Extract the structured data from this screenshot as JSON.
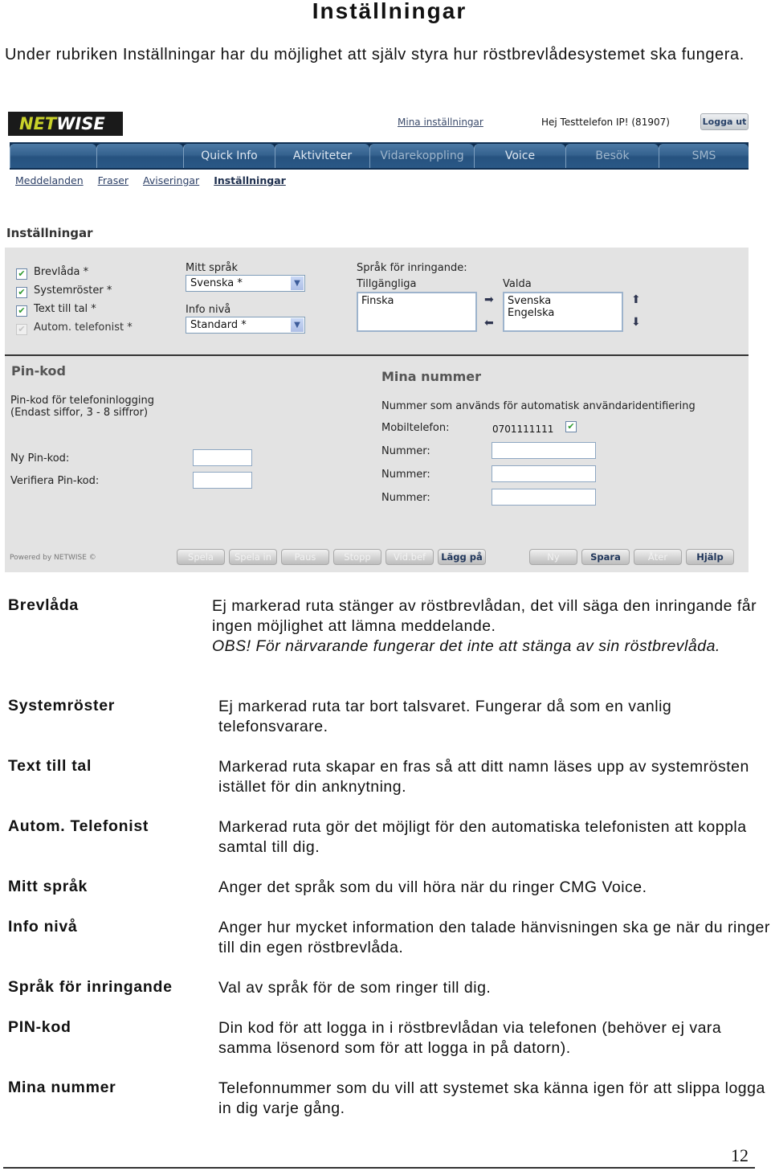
{
  "document": {
    "title": "Inställningar",
    "intro": "Under rubriken Inställningar har du möjlighet att själv styra hur röstbrevlådesystemet ska fungera.",
    "page_number": "12"
  },
  "app": {
    "logo": {
      "part1": "NET",
      "part2": "WISE"
    },
    "top_link": "Mina inställningar",
    "greeting": "Hej Testtelefon IP! (81907)",
    "logout_label": "Logga ut",
    "tabs": [
      {
        "label": ""
      },
      {
        "label": ""
      },
      {
        "label": "Quick Info"
      },
      {
        "label": "Aktiviteter"
      },
      {
        "label": "Vidarekoppling"
      },
      {
        "label": "Voice"
      },
      {
        "label": "Besök"
      },
      {
        "label": "SMS"
      }
    ],
    "subnav": [
      {
        "label": "Meddelanden",
        "active": false
      },
      {
        "label": "Fraser",
        "active": false
      },
      {
        "label": "Aviseringar",
        "active": false
      },
      {
        "label": "Inställningar",
        "active": true
      }
    ],
    "section_title": "Inställningar",
    "settings": {
      "checkboxes": [
        {
          "label": "Brevlåda *",
          "checked": true,
          "enabled": true
        },
        {
          "label": "Systemröster *",
          "checked": true,
          "enabled": true
        },
        {
          "label": "Text till tal *",
          "checked": true,
          "enabled": true
        },
        {
          "label": "Autom. telefonist *",
          "checked": true,
          "enabled": false
        }
      ],
      "my_language": {
        "label": "Mitt språk",
        "value": "Svenska *"
      },
      "info_level": {
        "label": "Info nivå",
        "value": "Standard *"
      },
      "caller_language": {
        "label": "Språk för inringande:",
        "available_label": "Tillgängliga",
        "available": [
          "Finska"
        ],
        "selected_label": "Valda",
        "selected": [
          "Svenska",
          "Engelska"
        ]
      }
    },
    "pin": {
      "title": "Pin-kod",
      "desc_line1": "Pin-kod för telefoninlogging",
      "desc_line2": "(Endast siffor, 3 - 8 siffror)",
      "new_label": "Ny Pin-kod:",
      "new_value": "",
      "verify_label": "Verifiera Pin-kod:",
      "verify_value": ""
    },
    "numbers": {
      "title": "Mina nummer",
      "desc": "Nummer som används för automatisk användaridentifiering",
      "mobile_label": "Mobiltelefon:",
      "mobile_value": "0701111111",
      "mobile_checked": true,
      "number_label": "Nummer:",
      "number_values": [
        "",
        "",
        ""
      ]
    },
    "powered_by": "Powered by NETWISE ©",
    "buttons": [
      {
        "label": "Spela",
        "enabled": false
      },
      {
        "label": "Spela in",
        "enabled": false
      },
      {
        "label": "Paus",
        "enabled": false
      },
      {
        "label": "Stopp",
        "enabled": false
      },
      {
        "label": "Vid.bef",
        "enabled": false
      },
      {
        "label": "Lägg på",
        "enabled": true
      },
      {
        "label": "Ny",
        "enabled": false
      },
      {
        "label": "Spara",
        "enabled": true
      },
      {
        "label": "Åter",
        "enabled": false
      },
      {
        "label": "Hjälp",
        "enabled": true
      }
    ]
  },
  "definitions": [
    {
      "term": "Brevlåda",
      "text": "Ej markerad ruta stänger av röstbrevlådan, det vill säga den inringande får ingen möjlighet att lämna meddelande.",
      "note": "OBS! För närvarande fungerar det inte att stänga av sin röstbrevlåda."
    },
    {
      "term": "Systemröster",
      "text": "Ej markerad ruta tar bort talsvaret. Fungerar då som en vanlig telefonsvarare."
    },
    {
      "term": "Text till tal",
      "text": "Markerad ruta skapar en fras så att ditt namn läses upp av systemrösten istället för din anknytning."
    },
    {
      "term": "Autom. Telefonist",
      "text": "Markerad ruta gör det möjligt för den automatiska telefonisten att koppla samtal till dig."
    },
    {
      "term": "Mitt språk",
      "text": "Anger det språk som du vill höra när du ringer CMG Voice."
    },
    {
      "term": "Info nivå",
      "text": "Anger hur mycket information den talade hänvisningen ska ge när du ringer till din egen röstbrevlåda."
    },
    {
      "term": "Språk för inringande",
      "text": "Val av språk för de som ringer till dig."
    },
    {
      "term": "PIN-kod",
      "text": "Din kod för att logga in i röstbrevlådan via telefonen (behöver ej vara samma lösenord som för att logga in på datorn)."
    },
    {
      "term": "Mina nummer",
      "text": "Telefonnummer som du vill att systemet ska känna igen för att slippa logga in dig varje gång."
    }
  ]
}
